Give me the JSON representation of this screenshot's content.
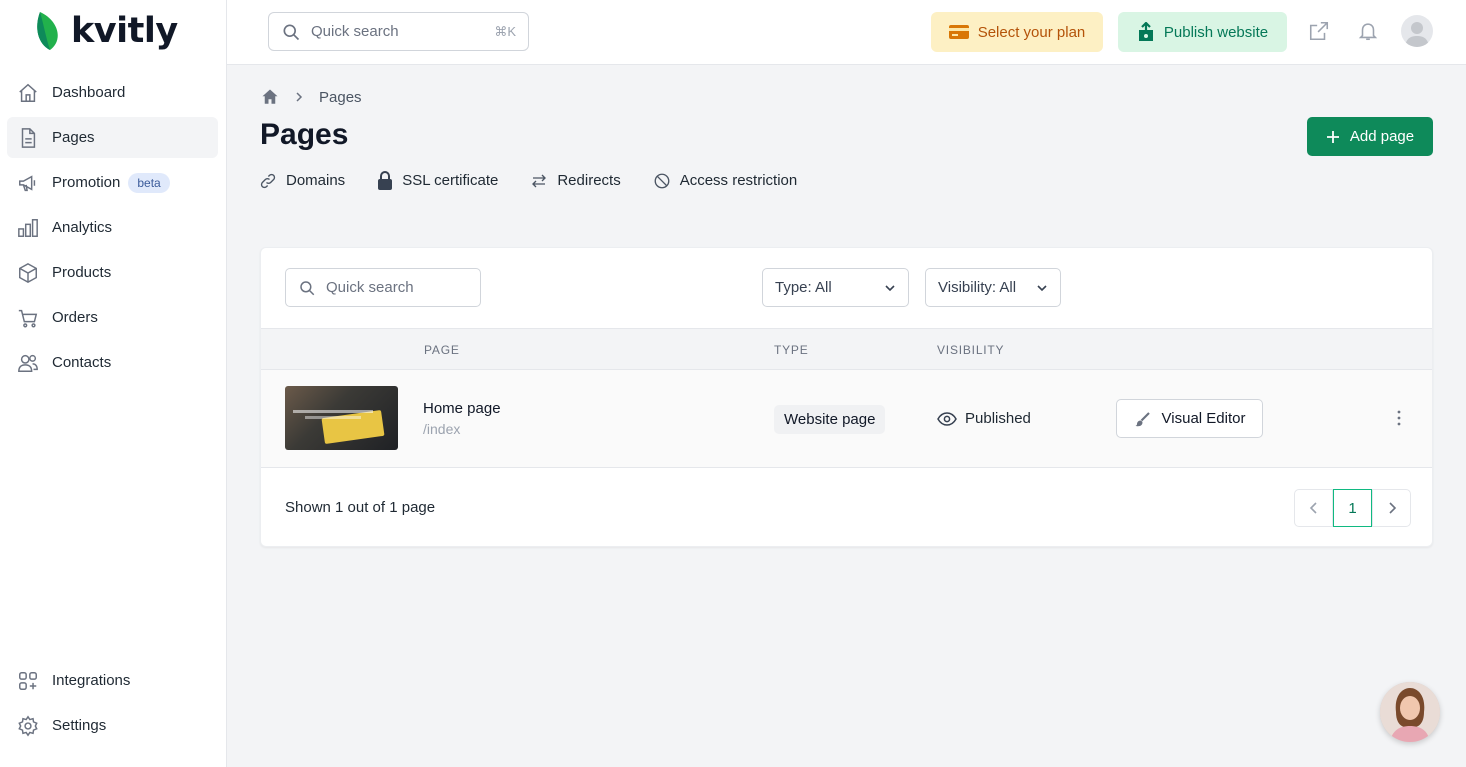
{
  "brand": {
    "name": "kvitly",
    "accent": "#0e8a5a",
    "logo_leaf": "#22b14c"
  },
  "sidebar": {
    "items": [
      {
        "label": "Dashboard",
        "icon": "home-icon"
      },
      {
        "label": "Pages",
        "icon": "document-icon",
        "active": true
      },
      {
        "label": "Promotion",
        "icon": "megaphone-icon",
        "badge": "beta"
      },
      {
        "label": "Analytics",
        "icon": "bar-chart-icon"
      },
      {
        "label": "Products",
        "icon": "box-icon"
      },
      {
        "label": "Orders",
        "icon": "cart-icon"
      },
      {
        "label": "Contacts",
        "icon": "users-icon"
      }
    ],
    "bottom_items": [
      {
        "label": "Integrations",
        "icon": "grid-plus-icon"
      },
      {
        "label": "Settings",
        "icon": "gear-icon"
      }
    ]
  },
  "topbar": {
    "search_placeholder": "Quick search",
    "search_shortcut": "⌘K",
    "plan_label": "Select your plan",
    "publish_label": "Publish website"
  },
  "breadcrumb": {
    "current": "Pages"
  },
  "page": {
    "title": "Pages",
    "add_label": "Add page",
    "subnav": [
      "Domains",
      "SSL certificate",
      "Redirects",
      "Access restriction"
    ]
  },
  "table": {
    "search_placeholder": "Quick search",
    "type_filter": "Type: All",
    "visibility_filter": "Visibility: All",
    "columns": [
      "PAGE",
      "TYPE",
      "VISIBILITY"
    ],
    "rows": [
      {
        "name": "Home page",
        "path": "/index",
        "type": "Website page",
        "visibility": "Published",
        "action": "Visual Editor"
      }
    ],
    "footer": "Shown 1 out of 1 page",
    "current_page": "1"
  }
}
